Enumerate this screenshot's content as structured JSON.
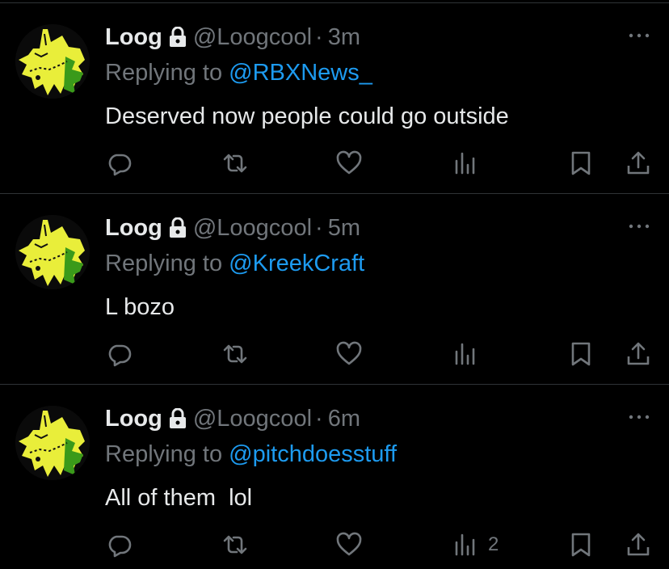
{
  "tweets": [
    {
      "name": "Loog",
      "handle": "@Loogcool",
      "separator": "·",
      "time": "3m",
      "reply_prefix": "Replying to ",
      "reply_to": "@RBXNews_",
      "text": "Deserved now people could go outside",
      "views": ""
    },
    {
      "name": "Loog",
      "handle": "@Loogcool",
      "separator": "·",
      "time": "5m",
      "reply_prefix": "Replying to ",
      "reply_to": "@KreekCraft",
      "text": "L bozo",
      "views": ""
    },
    {
      "name": "Loog",
      "handle": "@Loogcool",
      "separator": "·",
      "time": "6m",
      "reply_prefix": "Replying to ",
      "reply_to": "@pitchdoesstuff",
      "text": "All of them  lol",
      "views": "2"
    }
  ],
  "icons": {
    "lock": "lock-icon",
    "more": "more-icon",
    "reply": "reply-icon",
    "retweet": "retweet-icon",
    "like": "heart-icon",
    "views": "views-icon",
    "bookmark": "bookmark-icon",
    "share": "share-icon"
  },
  "colors": {
    "background": "#000000",
    "text": "#e7e9ea",
    "muted": "#71767b",
    "link": "#1d9bf0",
    "divider": "#2f3336",
    "avatar_yellow": "#e9ee3a"
  }
}
